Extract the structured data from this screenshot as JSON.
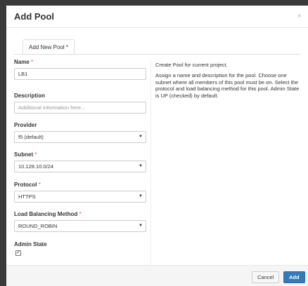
{
  "dialog": {
    "title": "Add Pool",
    "close_glyph": "×"
  },
  "tabs": [
    {
      "label": "Add New Pool *"
    }
  ],
  "form": {
    "name": {
      "label": "Name",
      "required_mark": "*",
      "value": "LB1"
    },
    "description": {
      "label": "Description",
      "placeholder": "Additional information here..."
    },
    "provider": {
      "label": "Provider",
      "value": "f5 (default)"
    },
    "subnet": {
      "label": "Subnet",
      "required_mark": "*",
      "value": "10.128.10.0/24"
    },
    "protocol": {
      "label": "Protocol",
      "required_mark": "*",
      "value": "HTTPS"
    },
    "lb_method": {
      "label": "Load Balancing Method",
      "required_mark": "*",
      "value": "ROUND_ROBIN"
    },
    "admin_state": {
      "label": "Admin State",
      "checked": true,
      "check_glyph": "✓"
    }
  },
  "help": {
    "p1": "Create Pool for current project.",
    "p2": "Assign a name and description for the pool. Choose one subnet where all members of this pool must be on. Select the protocol and load balancing method for this pool. Admin State is UP (checked) by default."
  },
  "footer": {
    "cancel_label": "Cancel",
    "add_label": "Add"
  },
  "icons": {
    "caret": "▼"
  },
  "colors": {
    "primary": "#337ab7",
    "required": "#d9534f"
  }
}
